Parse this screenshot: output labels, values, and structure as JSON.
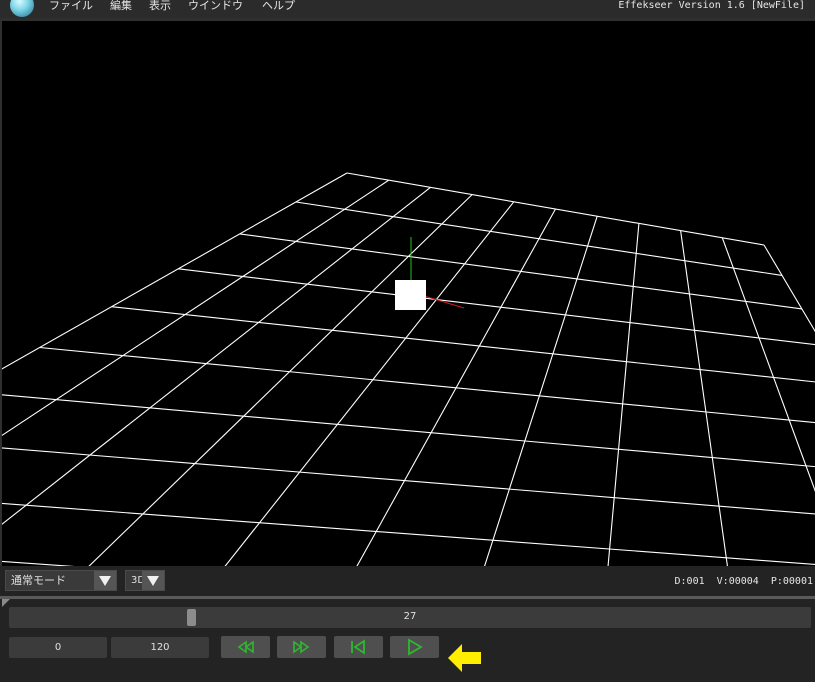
{
  "menubar": {
    "items": [
      {
        "label": "ファイル"
      },
      {
        "label": "編集"
      },
      {
        "label": "表示"
      },
      {
        "label": "ウインドウ"
      },
      {
        "label": "ヘルプ"
      }
    ],
    "app_title": "Effekseer Version 1.6 [NewFile]"
  },
  "viewport": {
    "grid_color": "#ffffff",
    "axis_colors": {
      "x": "#d01818",
      "y": "#1fbf1f"
    }
  },
  "toolbar": {
    "mode_select": "通常モード",
    "view_select": "3D",
    "stats": "D:001  V:00004  P:00001"
  },
  "timeline": {
    "current_frame": "27",
    "progress": 0.225,
    "start_frame": "0",
    "end_frame": "120"
  },
  "playback": {
    "buttons": [
      "rewind-icon",
      "fast-forward-icon",
      "skip-to-start-icon",
      "play-icon"
    ],
    "icon_color": "#2eb82e"
  },
  "hint": {
    "icon": "arrow-left-icon",
    "color": "#ffee00"
  }
}
